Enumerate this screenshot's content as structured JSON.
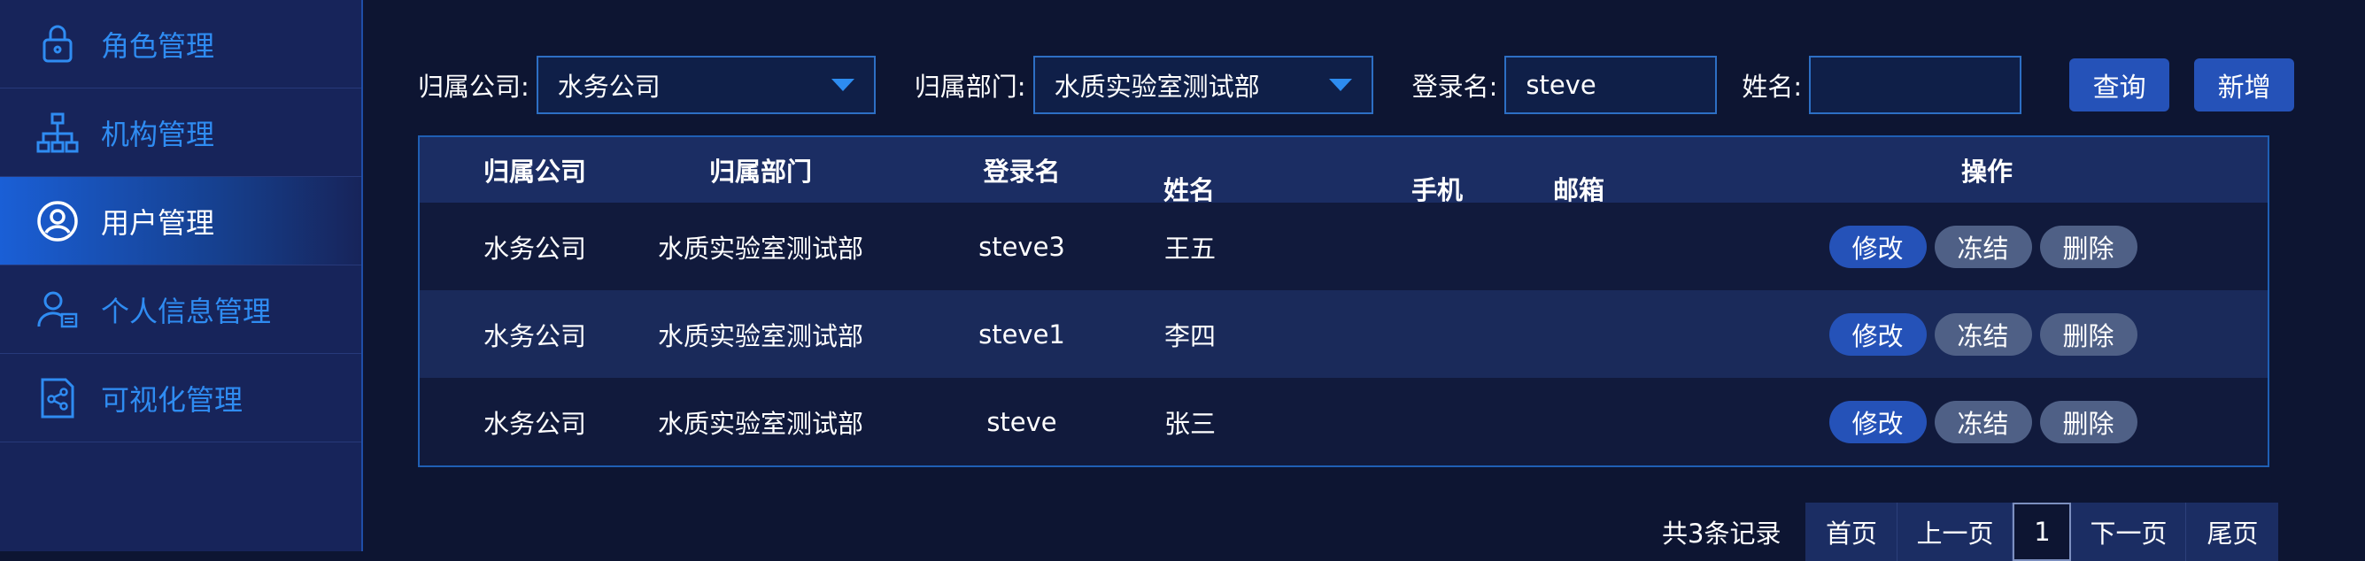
{
  "sidebar": {
    "items": [
      {
        "label": "角色管理",
        "icon": "lock-icon",
        "active": false
      },
      {
        "label": "机构管理",
        "icon": "org-chart-icon",
        "active": false
      },
      {
        "label": "用户管理",
        "icon": "user-circle-icon",
        "active": true
      },
      {
        "label": "个人信息管理",
        "icon": "user-profile-icon",
        "active": false
      },
      {
        "label": "可视化管理",
        "icon": "share-document-icon",
        "active": false
      }
    ]
  },
  "filters": {
    "company_label": "归属公司:",
    "company_value": "水务公司",
    "dept_label": "归属部门:",
    "dept_value": "水质实验室测试部",
    "login_label": "登录名:",
    "login_value": "steve",
    "name_label": "姓名:",
    "name_value": "",
    "search_button": "查询",
    "add_button": "新增"
  },
  "table": {
    "headers": [
      "归属公司",
      "归属部门",
      "登录名",
      "姓名",
      "手机",
      "邮箱",
      "操作"
    ],
    "rows": [
      {
        "company": "水务公司",
        "dept": "水质实验室测试部",
        "login": "steve3",
        "name": "王五",
        "phone": "",
        "email": ""
      },
      {
        "company": "水务公司",
        "dept": "水质实验室测试部",
        "login": "steve1",
        "name": "李四",
        "phone": "",
        "email": ""
      },
      {
        "company": "水务公司",
        "dept": "水质实验室测试部",
        "login": "steve",
        "name": "张三",
        "phone": "",
        "email": ""
      }
    ],
    "actions": {
      "edit": "修改",
      "freeze": "冻结",
      "delete": "删除"
    }
  },
  "pagination": {
    "total": "共3条记录",
    "first": "首页",
    "prev": "上一页",
    "current": "1",
    "next": "下一页",
    "last": "尾页"
  },
  "colors": {
    "accent": "#2552b8",
    "sidebar_text": "#2f8cf2",
    "background": "#0d1532"
  }
}
